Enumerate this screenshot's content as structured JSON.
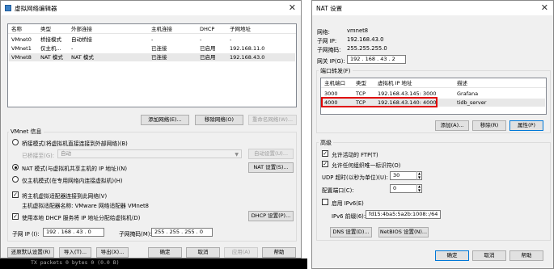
{
  "left_window": {
    "title": "虚拟网络编辑器",
    "table": {
      "headers": [
        "名称",
        "类型",
        "外部连接",
        "主机连接",
        "DHCP",
        "子网地址"
      ],
      "rows": [
        [
          "VMnet0",
          "桥接模式",
          "自动桥接",
          "-",
          "-",
          "-"
        ],
        [
          "VMnet1",
          "仅主机...",
          "-",
          "已连接",
          "已启用",
          "192.168.11.0"
        ],
        [
          "VMnet8",
          "NAT 模式",
          "NAT 模式",
          "已连接",
          "已启用",
          "192.168.43.0"
        ]
      ]
    },
    "buttons": {
      "add_network": "添加网络(E)...",
      "remove_network": "移除网络(O)",
      "rename_network": "重命名网络(W)..."
    },
    "vmnet_info": {
      "group_title": "VMnet 信息",
      "bridged_label": "桥接模式(将虚拟机直接连接到外部网络)(B)",
      "bridged_to_label": "已桥接至(G):",
      "bridged_to_value": "自动",
      "auto_settings": "自动设置(U)...",
      "nat_label": "NAT 模式(与虚拟机共享主机的 IP 地址)(N)",
      "nat_settings": "NAT 设置(S)...",
      "hostonly_label": "仅主机模式(在专用网络内连接虚拟机)(H)",
      "connect_adapter_label": "将主机虚拟适配器连接到此网络(V)",
      "adapter_name_label": "主机虚拟适配器名称: VMware 网络适配器 VMnet8",
      "dhcp_label": "使用本地 DHCP 服务将 IP 地址分配给虚拟机(D)",
      "dhcp_settings": "DHCP 设置(P)...",
      "subnet_ip_label": "子网 IP (I):",
      "subnet_ip_value": "192 . 168 . 43 . 0",
      "subnet_mask_label": "子网掩码(M):",
      "subnet_mask_value": "255 . 255 . 255 . 0"
    },
    "bottom_buttons": {
      "restore": "还原默认设置(R)",
      "import": "导入(T)...",
      "export": "导出(X)...",
      "ok": "确定",
      "cancel": "取消",
      "apply": "应用(A)",
      "help": "帮助"
    }
  },
  "terminal_text": "TX packets 0  bytes 0 (0.0 B)",
  "right_window": {
    "title": "NAT 设置",
    "network_label": "网络:",
    "network_value": "vmnet8",
    "subnet_ip_label": "子网 IP:",
    "subnet_ip_value": "192.168.43.0",
    "subnet_mask_label": "子网掩码:",
    "subnet_mask_value": "255.255.255.0",
    "gateway_label": "网关 IP(G):",
    "gateway_value": "192 . 168 . 43 . 2",
    "port_forward_title": "端口转发(F)",
    "pf_headers": [
      "主机端口",
      "类型",
      "虚拟机 IP 地址",
      "描述"
    ],
    "pf_rows": [
      [
        "3000",
        "TCP",
        "192.168.43.145: 3000",
        "Grafana"
      ],
      [
        "4000",
        "TCP",
        "192.168.43.140: 4000",
        "tidb_server"
      ]
    ],
    "pf_buttons": {
      "add": "添加(A)...",
      "remove": "移除(R)",
      "properties": "属性(P)"
    },
    "advanced_title": "高级",
    "allow_ftp": "允许活动的 FTP(T)",
    "allow_any_oui": "允许任何组织唯一标识符(O)",
    "udp_timeout_label": "UDP 超时(以秒为单位)(U):",
    "udp_timeout_value": "30",
    "config_port_label": "配置端口(C):",
    "config_port_value": "0",
    "enable_ipv6": "启用 IPv6(E)",
    "ipv6_prefix_label": "IPv6 前缀(6):",
    "ipv6_prefix_value": "fd15:4ba5:5a2b:1008::/64",
    "dns_settings": "DNS 设置(D)...",
    "netbios_settings": "NetBIOS 设置(N)...",
    "ok": "确定",
    "cancel": "取消",
    "help": "帮助"
  }
}
